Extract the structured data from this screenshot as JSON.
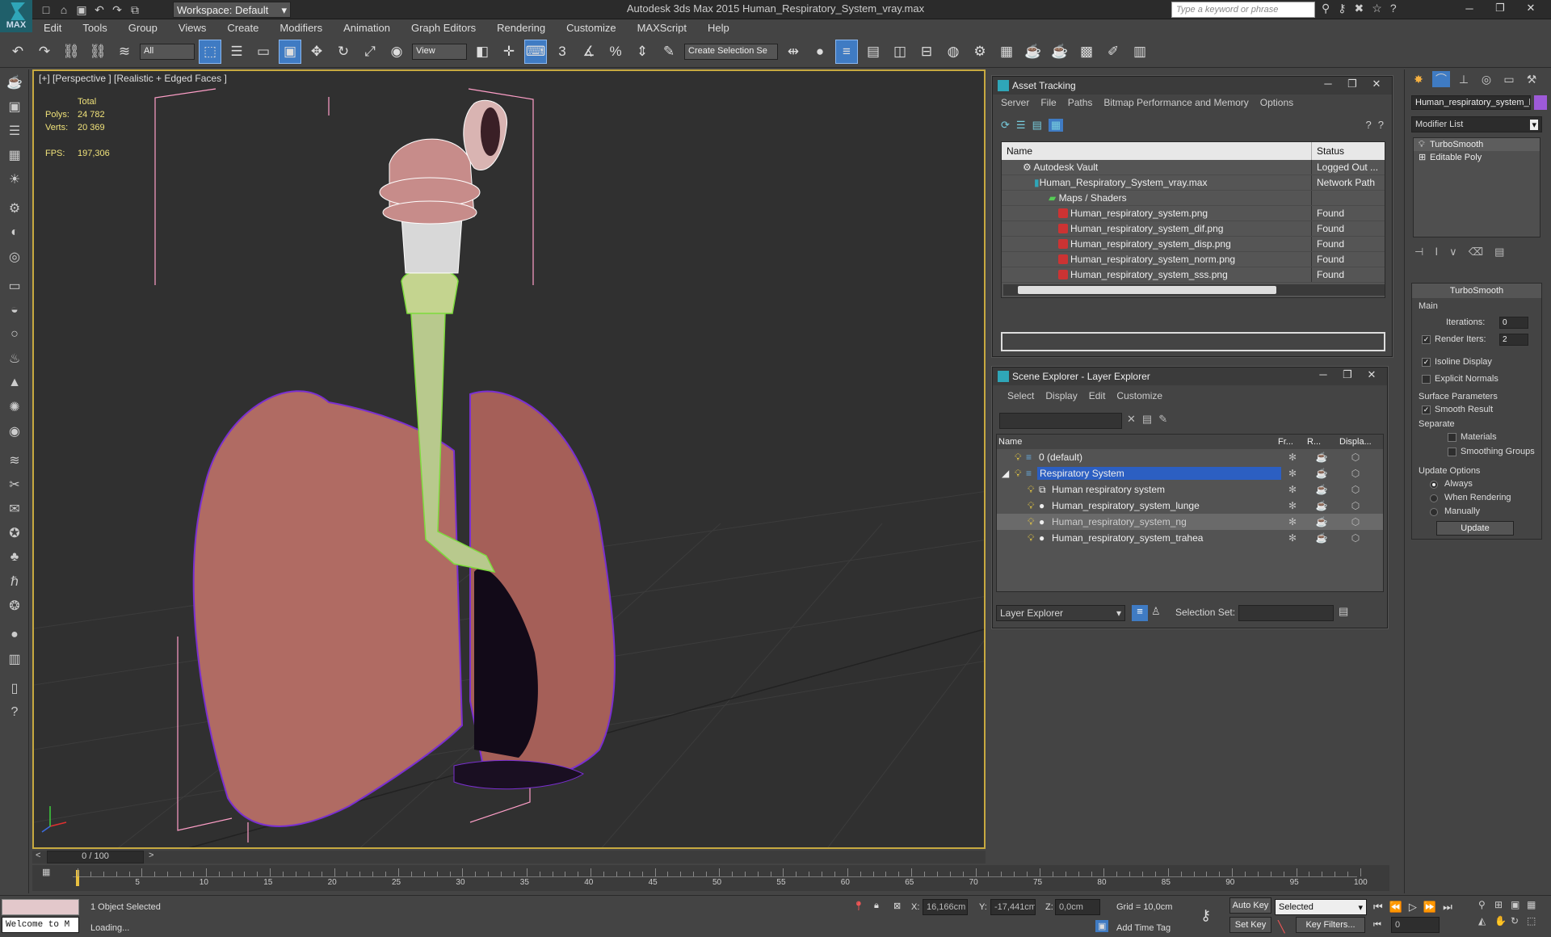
{
  "app": {
    "logo_text": "MAX",
    "workspace": "Workspace: Default",
    "window_title": "Autodesk 3ds Max  2015     Human_Respiratory_System_vray.max",
    "search_placeholder": "Type a keyword or phrase"
  },
  "menu": [
    "Edit",
    "Tools",
    "Group",
    "Views",
    "Create",
    "Modifiers",
    "Animation",
    "Graph Editors",
    "Rendering",
    "Customize",
    "MAXScript",
    "Help"
  ],
  "toolbar": {
    "selection_filter": "All",
    "ref_coord": "View",
    "create_selection_set": "Create Selection Se",
    "snap_labels": [
      "3",
      "%"
    ]
  },
  "viewport": {
    "label": "[+] [Perspective ] [Realistic + Edged Faces ]",
    "stats": {
      "total_label": "Total",
      "polys_label": "Polys:",
      "polys": "24 782",
      "verts_label": "Verts:",
      "verts": "20 369",
      "fps_label": "FPS:",
      "fps": "197,306"
    }
  },
  "asset_tracking": {
    "title": "Asset Tracking",
    "menu": [
      "Server",
      "File",
      "Paths",
      "Bitmap Performance and Memory",
      "Options"
    ],
    "columns": [
      "Name",
      "Status"
    ],
    "rows": [
      {
        "name": "Autodesk Vault",
        "status": "Logged Out ..."
      },
      {
        "name": "Human_Respiratory_System_vray.max",
        "status": "Network Path"
      },
      {
        "name": "Maps / Shaders",
        "status": ""
      },
      {
        "name": "Human_respiratory_system.png",
        "status": "Found"
      },
      {
        "name": "Human_respiratory_system_dif.png",
        "status": "Found"
      },
      {
        "name": "Human_respiratory_system_disp.png",
        "status": "Found"
      },
      {
        "name": "Human_respiratory_system_norm.png",
        "status": "Found"
      },
      {
        "name": "Human_respiratory_system_sss.png",
        "status": "Found"
      }
    ]
  },
  "scene_explorer": {
    "title": "Scene Explorer - Layer Explorer",
    "menu": [
      "Select",
      "Display",
      "Edit",
      "Customize"
    ],
    "columns": [
      "Name",
      "Fr...",
      "R...",
      "Displa..."
    ],
    "rows": [
      {
        "name": "0 (default)"
      },
      {
        "name": "Respiratory System"
      },
      {
        "name": "Human respiratory system"
      },
      {
        "name": "Human_respiratory_system_lunge"
      },
      {
        "name": "Human_respiratory_system_ng"
      },
      {
        "name": "Human_respiratory_system_trahea"
      }
    ],
    "footer_mode": "Layer Explorer",
    "selection_set_label": "Selection Set:"
  },
  "command_panel": {
    "object_name": "Human_respiratory_system_l",
    "object_color": "#9d5ad8",
    "modifier_list": "Modifier List",
    "stack": [
      "TurboSmooth",
      "Editable Poly"
    ],
    "turbosmooth": {
      "title": "TurboSmooth",
      "main": "Main",
      "iterations_label": "Iterations:",
      "iterations": "0",
      "render_iters_label": "Render Iters:",
      "render_iters": "2",
      "isoline": "Isoline Display",
      "explicit_normals": "Explicit Normals",
      "surface_params": "Surface Parameters",
      "smooth_result": "Smooth Result",
      "separate": "Separate",
      "materials": "Materials",
      "smoothing_groups": "Smoothing Groups",
      "update_options": "Update Options",
      "always": "Always",
      "when_rendering": "When Rendering",
      "manually": "Manually",
      "update": "Update"
    }
  },
  "timeline": {
    "frame": "0 / 100",
    "ticks": [
      "5",
      "10",
      "15",
      "20",
      "25",
      "30",
      "35",
      "40",
      "45",
      "50",
      "55",
      "60",
      "65",
      "70",
      "75",
      "80",
      "85",
      "90",
      "95",
      "100"
    ]
  },
  "status": {
    "maxscript": "Welcome to M",
    "selected": "1 Object Selected",
    "loading": "Loading...",
    "x_label": "X:",
    "x": "16,166cm",
    "y_label": "Y:",
    "y": "-17,441cm",
    "z_label": "Z:",
    "z": "0,0cm",
    "grid": "Grid = 10,0cm",
    "add_time_tag": "Add Time Tag",
    "auto_key": "Auto Key",
    "set_key": "Set Key",
    "selected_mode": "Selected",
    "key_filters": "Key Filters...",
    "frame_field": "0"
  }
}
